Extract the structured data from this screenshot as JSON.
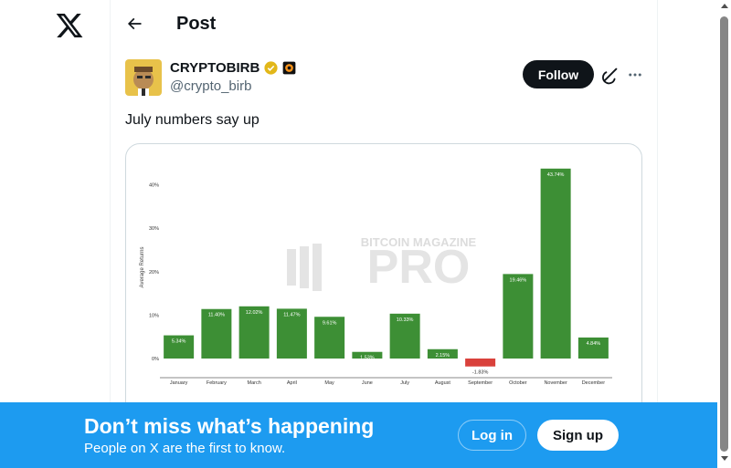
{
  "nav": {
    "logo_icon": "x-logo-icon"
  },
  "header": {
    "title": "Post",
    "back_icon": "arrow-left-icon"
  },
  "post": {
    "author_name": "CRYPTOBIRB",
    "verified_icon": "verified-gold-badge-icon",
    "affiliate_icon": "affiliate-badge-icon",
    "handle": "@crypto_birb",
    "follow_label": "Follow",
    "grok_icon": "grok-icon",
    "more_icon": "more-dots-icon",
    "text": "July numbers say up"
  },
  "chart_data": {
    "type": "bar",
    "title": "",
    "watermark": "BITCOIN MAGAZINE PRO",
    "ylabel": "Average Returns",
    "xlabel": "",
    "ylim": [
      -3,
      45
    ],
    "yticks": [
      "0%",
      "10%",
      "20%",
      "30%",
      "40%"
    ],
    "categories": [
      "January",
      "February",
      "March",
      "April",
      "May",
      "June",
      "July",
      "August",
      "September",
      "October",
      "November",
      "December"
    ],
    "values": [
      5.34,
      11.4,
      12.02,
      11.47,
      9.61,
      1.53,
      10.33,
      2.15,
      -1.83,
      19.46,
      43.74,
      4.84
    ],
    "labels": [
      "5.34%",
      "11.40%",
      "12.02%",
      "11.47%",
      "9.61%",
      "1.53%",
      "10.33%",
      "2.15%",
      "-1.83%",
      "19.46%",
      "43.74%",
      "4.84%"
    ],
    "positive_color": "#3d8f35",
    "negative_color": "#d9413b",
    "grid": false
  },
  "banner": {
    "title": "Don’t miss what’s happening",
    "subtitle": "People on X are the first to know.",
    "login_label": "Log in",
    "signup_label": "Sign up",
    "background": "#1d9bf0"
  }
}
